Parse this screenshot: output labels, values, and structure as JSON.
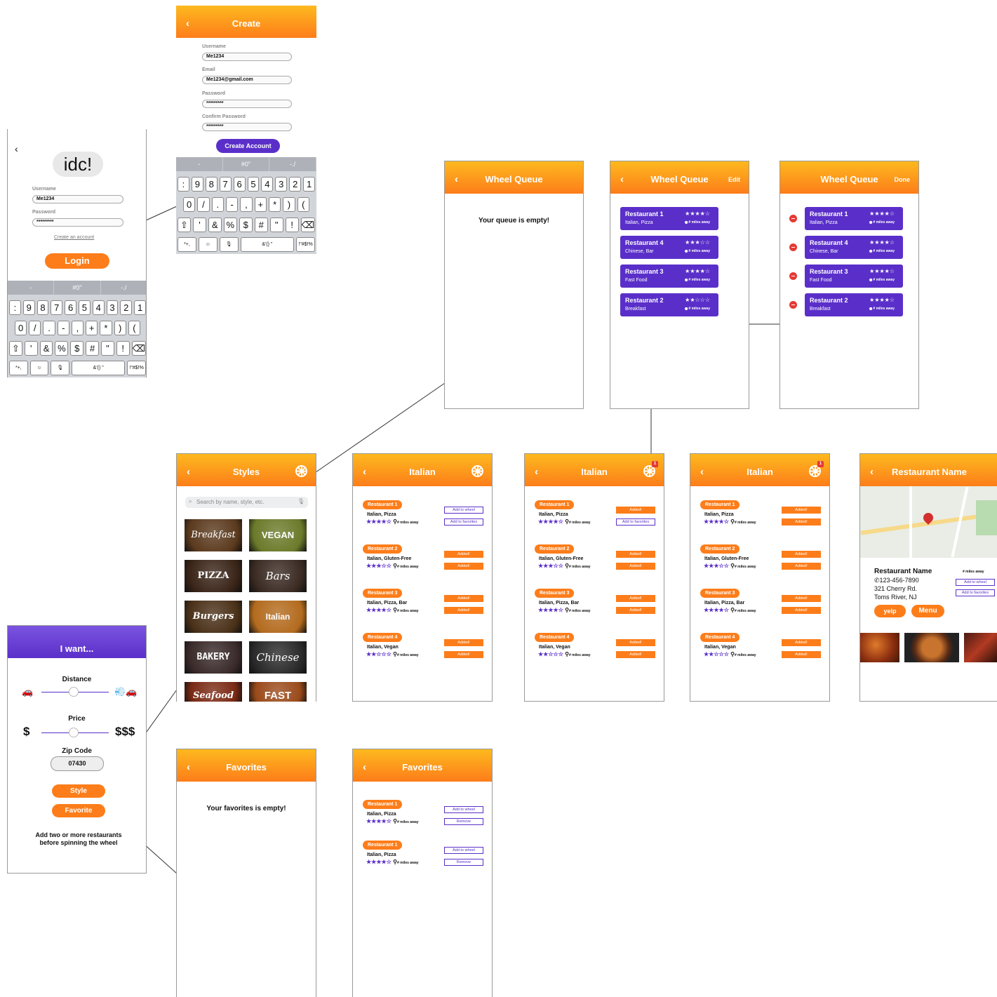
{
  "login": {
    "logo": "idc!",
    "username_label": "Username",
    "username": "Me1234",
    "password_label": "Password",
    "password": "*********",
    "create_link": "Create an account",
    "login_btn": "Login"
  },
  "create": {
    "title": "Create",
    "username_label": "Username",
    "username": "Me1234",
    "email_label": "Email",
    "email": "Me1234@gmail.com",
    "password_label": "Password",
    "password": "*********",
    "confirm_label": "Confirm Password",
    "confirm": "*********",
    "btn": "Create Account"
  },
  "keyboard": {
    "bar": [
      "-",
      "#0\"",
      "-./"
    ],
    "row1": [
      ":",
      "9",
      "8",
      "7",
      "6",
      "5",
      "4",
      "3",
      "2",
      "1"
    ],
    "row2": [
      "0",
      "/",
      ".",
      "-",
      ",",
      "+",
      "*",
      ")",
      "("
    ],
    "row3": [
      "⇧",
      "'",
      "&",
      "%",
      "$",
      "#",
      "\"",
      "!",
      "⌫"
    ],
    "row4": [
      "*+,",
      "☺",
      "🎙",
      "&'() \"",
      "!\"#$!%"
    ]
  },
  "queue_empty": {
    "title": "Wheel Queue",
    "msg": "Your queue is empty!"
  },
  "queue": {
    "title": "Wheel Queue",
    "edit": "Edit",
    "done": "Done",
    "items": [
      {
        "name": "Restaurant 1",
        "cat": "Italian, Pizza",
        "stars": "★★★★☆",
        "miles": "# miles away"
      },
      {
        "name": "Restaurant 4",
        "cat": "Chinese, Bar",
        "stars": "★★★☆☆",
        "miles": "# miles away"
      },
      {
        "name": "Restaurant 3",
        "cat": "Fast Food",
        "stars": "★★★★☆",
        "miles": "# miles away"
      },
      {
        "name": "Restaurant 2",
        "cat": "Breakfast",
        "stars": "★★☆☆☆",
        "miles": "# miles away"
      }
    ]
  },
  "queue_edit": {
    "items": [
      {
        "name": "Restaurant 1",
        "cat": "Italian, Pizza",
        "stars": "★★★★☆",
        "miles": "# miles away"
      },
      {
        "name": "Restaurant 4",
        "cat": "Chinese, Bar",
        "stars": "★★★★☆",
        "miles": "# miles away"
      },
      {
        "name": "Restaurant 3",
        "cat": "Fast Food",
        "stars": "★★★★☆",
        "miles": "# miles away"
      },
      {
        "name": "Restaurant 2",
        "cat": "Breakfast",
        "stars": "★★★★☆",
        "miles": "# miles away"
      }
    ]
  },
  "styles": {
    "title": "Styles",
    "search": "Search by name, style, etc.",
    "tiles": [
      "Breakfast",
      "VEGAN",
      "PIZZA",
      "Bars",
      "Burgers",
      "Italian",
      "BAKERY",
      "Chinese",
      "Seafood",
      "FAST FOOD"
    ]
  },
  "italian": {
    "title": "Italian",
    "add_wheel": "Add to wheel",
    "add_fav": "Add to favorites",
    "added": "Added!",
    "items": [
      {
        "name": "Restaurant 1",
        "cat": "Italian, Pizza",
        "stars": "★★★★☆",
        "miles": "# miles away"
      },
      {
        "name": "Restaurant 2",
        "cat": "Italian, Gluten-Free",
        "stars": "★★★☆☆",
        "miles": "# miles away"
      },
      {
        "name": "Restaurant 3",
        "cat": "Italian, Pizza, Bar",
        "stars": "★★★★☆",
        "miles": "# miles away"
      },
      {
        "name": "Restaurant 4",
        "cat": "Italian, Vegan",
        "stars": "★★☆☆☆",
        "miles": "# miles away"
      }
    ],
    "badge": "1"
  },
  "detail": {
    "title": "Restaurant Name",
    "name": "Restaurant Name",
    "phone": "123-456-7890",
    "addr1": "321 Cherry Rd.",
    "addr2": "Toms River, NJ",
    "miles": "# miles away",
    "add_wheel": "Add to wheel",
    "add_fav": "Add to favorites",
    "yelp": "yelp",
    "menu": "Menu"
  },
  "iwant": {
    "title": "I want...",
    "distance": "Distance",
    "price": "Price",
    "low": "$",
    "high": "$$$",
    "zip_label": "Zip Code",
    "zip": "07430",
    "style": "Style",
    "favorite": "Favorite",
    "note": "Add two or more restaurants before spinning the wheel",
    "distance_level": 0.48,
    "price_level": 0.48
  },
  "fav_empty": {
    "title": "Favorites",
    "msg": "Your favorites is empty!"
  },
  "favorites": {
    "title": "Favorites",
    "add_wheel": "Add to wheel",
    "remove": "Remove",
    "items": [
      {
        "name": "Restaurant 1",
        "cat": "Italian, Pizza",
        "stars": "★★★★☆",
        "miles": "# miles away"
      },
      {
        "name": "Restaurant 1",
        "cat": "Italian, Pizza",
        "stars": "★★★★☆",
        "miles": "# miles away"
      }
    ]
  },
  "colors": {
    "orange": "#fd7d1a",
    "purple": "#5a2fc9"
  }
}
